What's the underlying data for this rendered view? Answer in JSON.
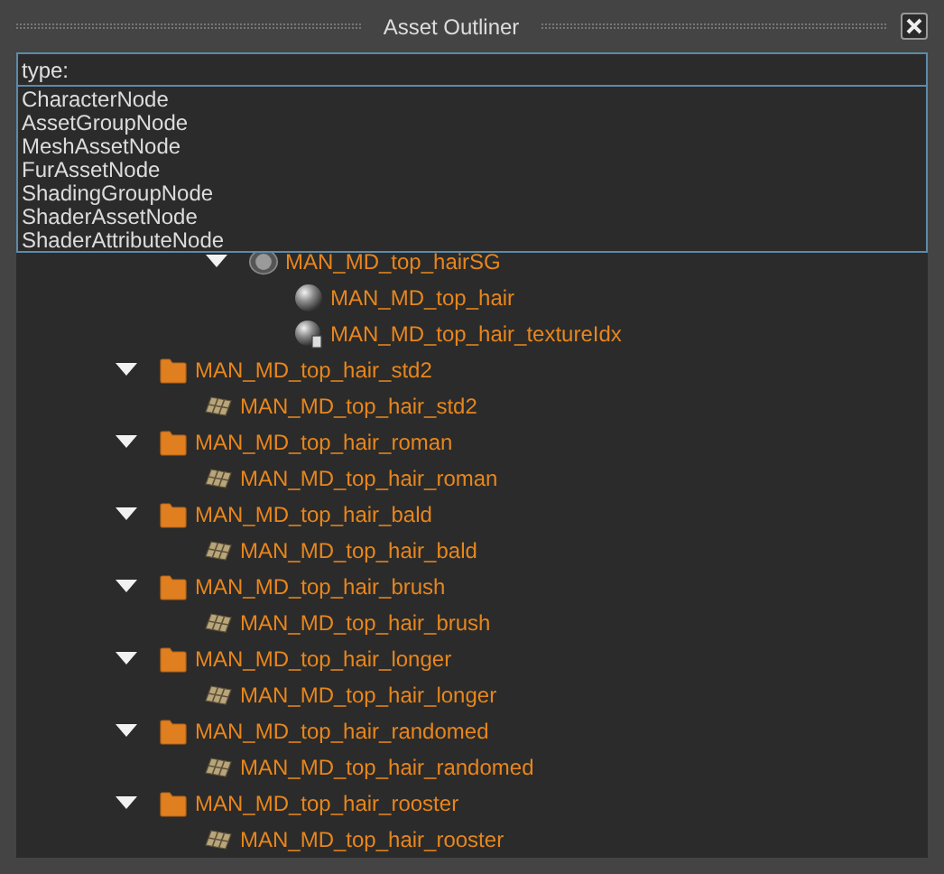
{
  "window": {
    "title": "Asset Outliner"
  },
  "filter": {
    "value": "type:"
  },
  "suggestions": [
    {
      "label": "CharacterNode"
    },
    {
      "label": "AssetGroupNode"
    },
    {
      "label": "MeshAssetNode"
    },
    {
      "label": "FurAssetNode"
    },
    {
      "label": "ShadingGroupNode"
    },
    {
      "label": "ShaderAssetNode"
    },
    {
      "label": "ShaderAttributeNode"
    }
  ],
  "partial_branch": {
    "kind": "shading-group",
    "name": "MAN_MD_top_hairSG",
    "expanded": true,
    "children": [
      {
        "kind": "shader",
        "name": "MAN_MD_top_hair"
      },
      {
        "kind": "shader-attribute",
        "name": "MAN_MD_top_hair_textureIdx"
      }
    ]
  },
  "tree": [
    {
      "kind": "group",
      "name": "MAN_MD_top_hair_std2",
      "expanded": true,
      "children": [
        {
          "kind": "mesh",
          "name": "MAN_MD_top_hair_std2"
        }
      ]
    },
    {
      "kind": "group",
      "name": "MAN_MD_top_hair_roman",
      "expanded": true,
      "children": [
        {
          "kind": "mesh",
          "name": "MAN_MD_top_hair_roman"
        }
      ]
    },
    {
      "kind": "group",
      "name": "MAN_MD_top_hair_bald",
      "expanded": true,
      "children": [
        {
          "kind": "mesh",
          "name": "MAN_MD_top_hair_bald"
        }
      ]
    },
    {
      "kind": "group",
      "name": "MAN_MD_top_hair_brush",
      "expanded": true,
      "children": [
        {
          "kind": "mesh",
          "name": "MAN_MD_top_hair_brush"
        }
      ]
    },
    {
      "kind": "group",
      "name": "MAN_MD_top_hair_longer",
      "expanded": true,
      "children": [
        {
          "kind": "mesh",
          "name": "MAN_MD_top_hair_longer"
        }
      ]
    },
    {
      "kind": "group",
      "name": "MAN_MD_top_hair_randomed",
      "expanded": true,
      "children": [
        {
          "kind": "mesh",
          "name": "MAN_MD_top_hair_randomed"
        }
      ]
    },
    {
      "kind": "group",
      "name": "MAN_MD_top_hair_rooster",
      "expanded": true,
      "children": [
        {
          "kind": "mesh",
          "name": "MAN_MD_top_hair_rooster"
        }
      ]
    }
  ]
}
